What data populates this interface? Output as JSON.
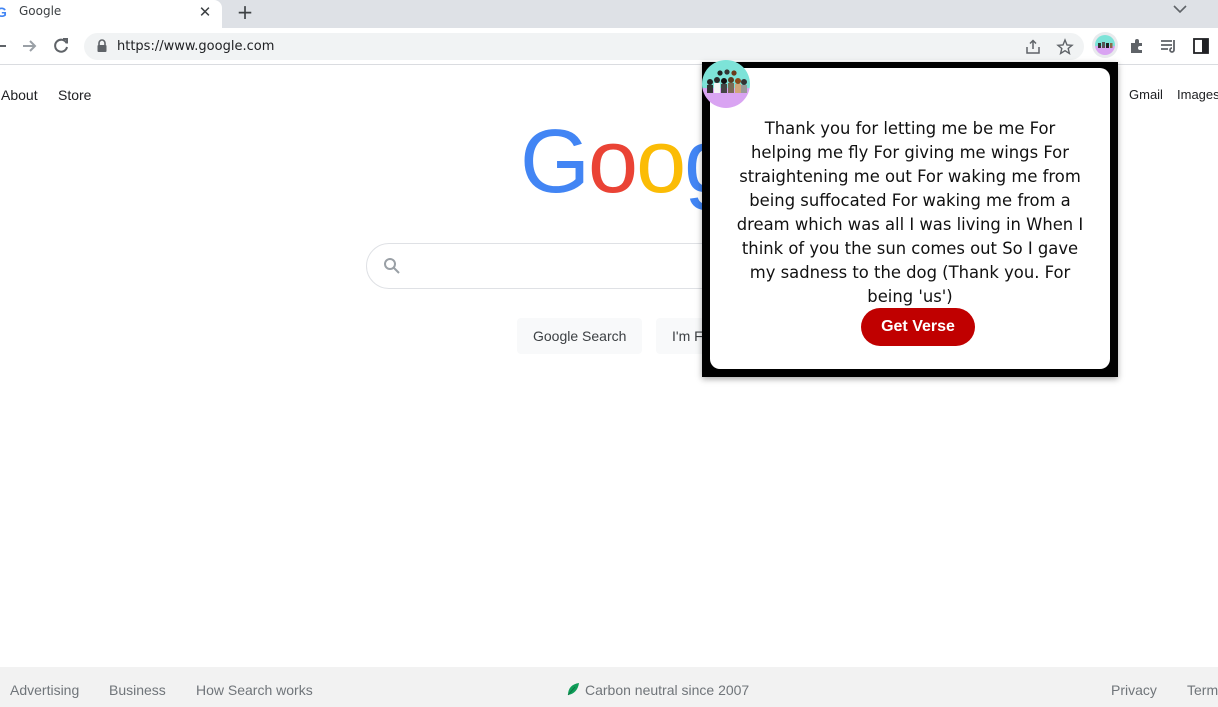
{
  "tab": {
    "title": "Google",
    "favicon": "G",
    "close": "✕",
    "new_tab": "+"
  },
  "address_bar": {
    "url": "https://www.google.com"
  },
  "page": {
    "top_links_left": [
      "About",
      "Store"
    ],
    "top_links_right": [
      "Gmail",
      "Images"
    ],
    "logo_letters": [
      {
        "char": "G",
        "color": "#4285f4"
      },
      {
        "char": "o",
        "color": "#ea4335"
      },
      {
        "char": "o",
        "color": "#fbbc05"
      },
      {
        "char": "g",
        "color": "#4285f4"
      }
    ],
    "search_button": "Google Search",
    "lucky_button": "I'm Feeling Lucky"
  },
  "footer": {
    "left_links": [
      "Advertising",
      "Business",
      "How Search works"
    ],
    "center_text": "Carbon neutral since 2007",
    "right_links": [
      "Privacy",
      "Terms"
    ]
  },
  "extension_popup": {
    "verse": "Thank you for letting me be me For helping me fly For giving me wings For straightening me out For waking me from being suffocated For waking me from a dream which was all I was living in When I think of you the sun comes out So I gave my sadness to the dog (Thank you. For being 'us')",
    "button_label": "Get Verse",
    "button_color": "#c00000"
  }
}
